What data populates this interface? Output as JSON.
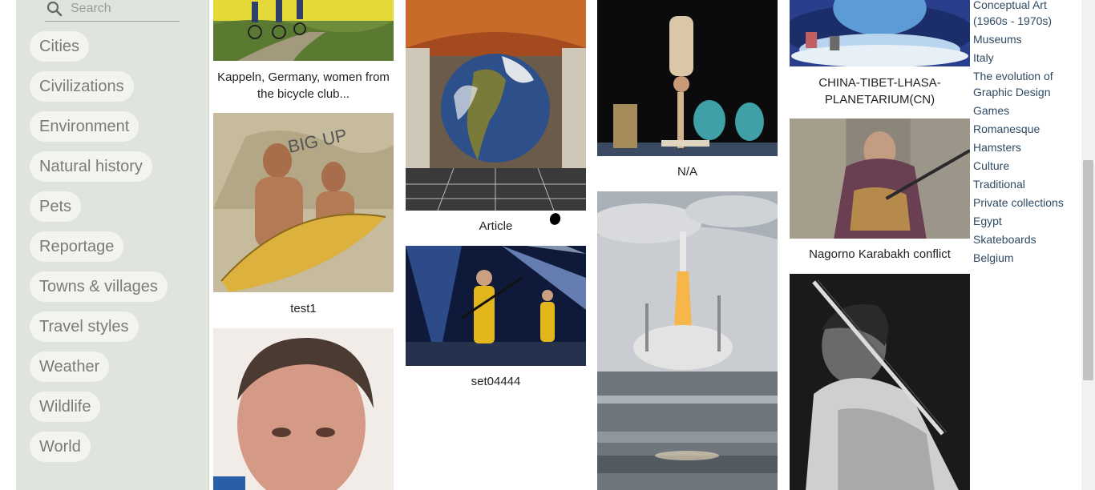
{
  "search": {
    "placeholder": "Search",
    "icon": "search-icon"
  },
  "categories": [
    "Cities",
    "Civilizations",
    "Environment",
    "Natural history",
    "Pets",
    "Reportage",
    "Towns & villages",
    "Travel styles",
    "Weather",
    "Wildlife",
    "World"
  ],
  "captions": {
    "bicycle": "Kappeln, Germany, women from the bicycle club...",
    "test1": "test1",
    "article": "Article",
    "set04444": "set04444",
    "na": "N/A",
    "planetarium": "CHINA-TIBET-LHASA-PLANETARIUM(CN)",
    "nagorno": "Nagorno Karabakh conflict"
  },
  "links": [
    "Conceptual Art (1960s - 1970s)",
    "Museums",
    "Italy",
    "The evolution of Graphic Design",
    "Games",
    "Romanesque",
    "Hamsters",
    "Culture",
    "Traditional",
    "Private collections",
    "Egypt",
    "Skateboards",
    "Belgium"
  ],
  "colors": {
    "sidebar": "#dfe5dc",
    "chip": "#f3f4ef",
    "link": "#2e4a63"
  }
}
